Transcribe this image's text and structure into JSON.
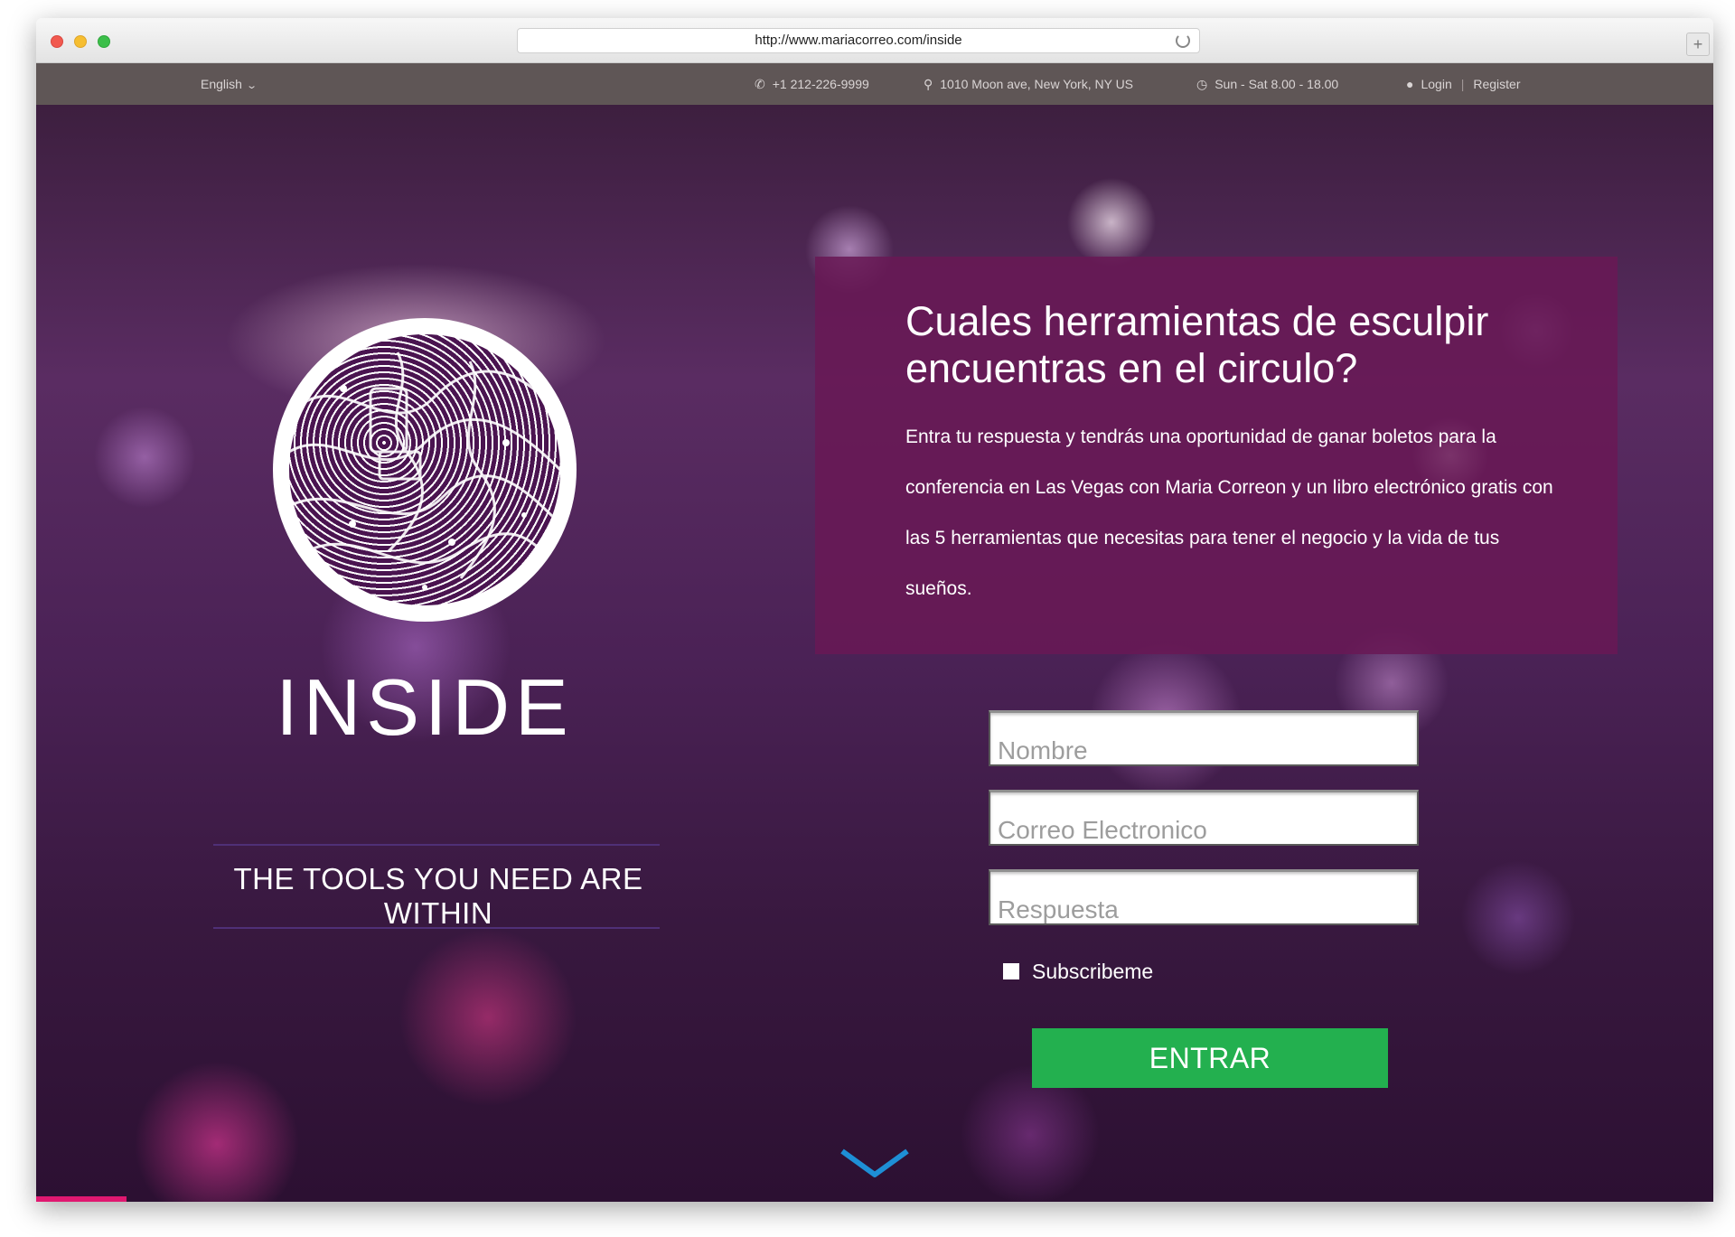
{
  "browser": {
    "url": "http://www.mariacorreo.com/inside",
    "new_tab_label": "+"
  },
  "topbar": {
    "language": "English",
    "phone": "+1 212-226-9999",
    "address": "1010 Moon ave, New York, NY US",
    "hours": "Sun - Sat 8.00 - 18.00",
    "login": "Login",
    "separator": "|",
    "register": "Register"
  },
  "hero": {
    "brand": "INSIDE",
    "tagline": "THE TOOLS YOU NEED ARE WITHIN"
  },
  "panel": {
    "heading": "Cuales herramientas de esculpir encuentras en el circulo?",
    "body": "Entra tu respuesta y tendrás una oportunidad de ganar boletos para la conferencia en Las Vegas con Maria Correon y un libro electrónico gratis con las 5 herramientas que necesitas para tener el negocio y la vida de tus sueños."
  },
  "form": {
    "name_placeholder": "Nombre",
    "email_placeholder": "Correo Electronico",
    "answer_placeholder": "Respuesta",
    "subscribe_label": "Subscribeme",
    "submit_label": "ENTRAR"
  },
  "icons": {
    "phone": "phone-icon",
    "location": "map-pin-icon",
    "clock": "clock-icon",
    "user": "user-icon",
    "chevron": "chevron-down-icon",
    "scroll": "scroll-down-icon"
  },
  "colors": {
    "topbar": "#5f5656",
    "panel": "#691955",
    "submit": "#23b04f",
    "scroll_arrow": "#1e8fd6"
  }
}
